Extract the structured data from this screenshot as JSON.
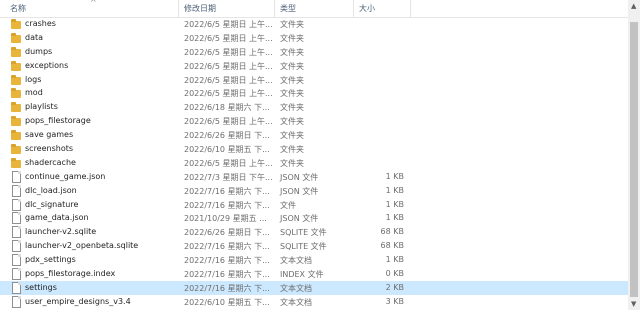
{
  "header": {
    "name": "名称",
    "date": "修改日期",
    "type": "类型",
    "size": "大小"
  },
  "files": [
    {
      "name": "crashes",
      "date": "2022/6/5 星期日 上午...",
      "type": "文件夹",
      "size": "",
      "icon": "folder-icon"
    },
    {
      "name": "data",
      "date": "2022/6/5 星期日 上午...",
      "type": "文件夹",
      "size": "",
      "icon": "folder-icon"
    },
    {
      "name": "dumps",
      "date": "2022/6/5 星期日 上午...",
      "type": "文件夹",
      "size": "",
      "icon": "folder-icon"
    },
    {
      "name": "exceptions",
      "date": "2022/6/5 星期日 上午...",
      "type": "文件夹",
      "size": "",
      "icon": "folder-icon"
    },
    {
      "name": "logs",
      "date": "2022/6/5 星期日 上午...",
      "type": "文件夹",
      "size": "",
      "icon": "folder-icon"
    },
    {
      "name": "mod",
      "date": "2022/6/5 星期日 上午...",
      "type": "文件夹",
      "size": "",
      "icon": "folder-icon"
    },
    {
      "name": "playlists",
      "date": "2022/6/18 星期六 下...",
      "type": "文件夹",
      "size": "",
      "icon": "folder-icon"
    },
    {
      "name": "pops_filestorage",
      "date": "2022/6/5 星期日 上午...",
      "type": "文件夹",
      "size": "",
      "icon": "folder-icon"
    },
    {
      "name": "save games",
      "date": "2022/6/26 星期日 下...",
      "type": "文件夹",
      "size": "",
      "icon": "folder-icon"
    },
    {
      "name": "screenshots",
      "date": "2022/6/10 星期五 下...",
      "type": "文件夹",
      "size": "",
      "icon": "folder-icon"
    },
    {
      "name": "shadercache",
      "date": "2022/6/5 星期日 上午...",
      "type": "文件夹",
      "size": "",
      "icon": "folder-icon"
    },
    {
      "name": "continue_game.json",
      "date": "2022/7/3 星期日 下午...",
      "type": "JSON 文件",
      "size": "1 KB",
      "icon": "file-icon"
    },
    {
      "name": "dlc_load.json",
      "date": "2022/7/16 星期六 下...",
      "type": "JSON 文件",
      "size": "1 KB",
      "icon": "file-icon"
    },
    {
      "name": "dlc_signature",
      "date": "2022/7/16 星期六 下...",
      "type": "文件",
      "size": "1 KB",
      "icon": "file-icon"
    },
    {
      "name": "game_data.json",
      "date": "2021/10/29 星期五 ...",
      "type": "JSON 文件",
      "size": "1 KB",
      "icon": "file-icon"
    },
    {
      "name": "launcher-v2.sqlite",
      "date": "2022/6/26 星期日 下...",
      "type": "SQLITE 文件",
      "size": "68 KB",
      "icon": "file-icon"
    },
    {
      "name": "launcher-v2_openbeta.sqlite",
      "date": "2022/7/16 星期六 下...",
      "type": "SQLITE 文件",
      "size": "68 KB",
      "icon": "file-icon"
    },
    {
      "name": "pdx_settings",
      "date": "2022/7/16 星期六 下...",
      "type": "文本文档",
      "size": "1 KB",
      "icon": "file-icon"
    },
    {
      "name": "pops_filestorage.index",
      "date": "2022/7/16 星期六 下...",
      "type": "INDEX 文件",
      "size": "0 KB",
      "icon": "file-icon"
    },
    {
      "name": "settings",
      "date": "2022/7/16 星期六 下...",
      "type": "文本文档",
      "size": "2 KB",
      "icon": "file-icon",
      "selected": true
    },
    {
      "name": "user_empire_designs_v3.4",
      "date": "2022/6/10 星期五 下...",
      "type": "文本文档",
      "size": "3 KB",
      "icon": "file-icon"
    }
  ],
  "colors": {
    "selection": "#cce8ff",
    "folder": "#e8b53a",
    "header_text": "#4c607a"
  }
}
